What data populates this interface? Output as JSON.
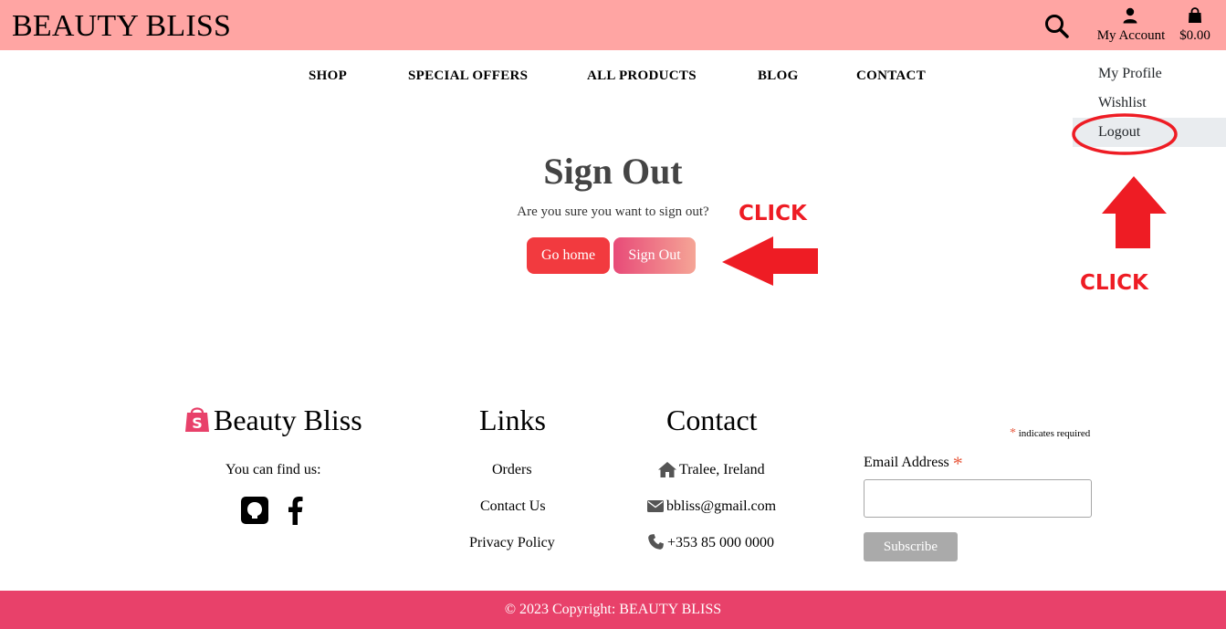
{
  "header": {
    "brand": "BEAUTY BLISS",
    "account_label": "My Account",
    "cart_total": "$0.00"
  },
  "nav": {
    "items": [
      "SHOP",
      "SPECIAL OFFERS",
      "ALL PRODUCTS",
      "BLOG",
      "CONTACT"
    ]
  },
  "account_menu": {
    "items": [
      "My Profile",
      "Wishlist",
      "Logout"
    ],
    "active_item": "Logout"
  },
  "main": {
    "title": "Sign Out",
    "question": "Are you sure you want to sign out?",
    "home_button": "Go home",
    "signout_button": "Sign Out"
  },
  "annotations": {
    "click_signout": "CLICK",
    "click_logout": "CLICK",
    "color": "#ee1c24"
  },
  "footer": {
    "brand": "Beauty Bliss",
    "find_us": "You can find us:",
    "links_title": "Links",
    "links": [
      "Orders",
      "Contact Us",
      "Privacy Policy"
    ],
    "contact_title": "Contact",
    "address": "Tralee, Ireland",
    "email": "bbliss@gmail.com",
    "phone": "+353 85 000 0000",
    "newsletter": {
      "required_star": "*",
      "required_note": "indicates required",
      "email_label": "Email Address",
      "email_value": "",
      "subscribe": "Subscribe"
    },
    "copyright": "© 2023 Copyright: BEAUTY BLISS"
  },
  "colors": {
    "header_bg": "#ffa5a3",
    "footer_bar": "#e8416a",
    "primary_button": "#f23a3f",
    "brand_icon": "#e8416a"
  },
  "icons": {
    "search": "search-icon",
    "account": "user-icon",
    "cart": "shopping-bag-icon",
    "brand": "shopify-bag-icon",
    "github": "github-icon",
    "facebook": "facebook-icon",
    "home": "home-icon",
    "email": "envelope-icon",
    "phone": "phone-icon"
  }
}
